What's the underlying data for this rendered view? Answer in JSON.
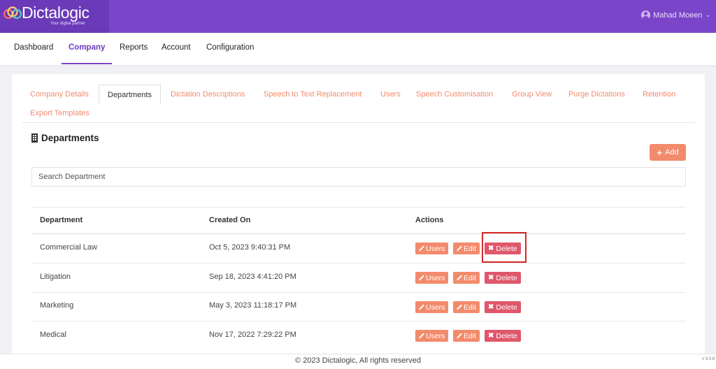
{
  "header": {
    "logo_text": "Dictalogic",
    "logo_tagline": "Your digital partner",
    "user_name": "Mahad Moeen"
  },
  "nav": {
    "items": [
      {
        "label": "Dashboard"
      },
      {
        "label": "Company"
      },
      {
        "label": "Reports"
      },
      {
        "label": "Account"
      },
      {
        "label": "Configuration"
      }
    ],
    "active": "Company"
  },
  "tabs": {
    "items": [
      {
        "label": "Company Details"
      },
      {
        "label": "Departments"
      },
      {
        "label": "Dictation Descriptions"
      },
      {
        "label": "Speech to Text Replacement"
      },
      {
        "label": "Users"
      },
      {
        "label": "Speech Customisation"
      },
      {
        "label": "Group View"
      },
      {
        "label": "Purge Dictations"
      },
      {
        "label": "Retention"
      },
      {
        "label": "Export Templates"
      }
    ],
    "active": "Departments"
  },
  "page": {
    "title": "Departments",
    "add_label": "Add",
    "search_placeholder": "Search Department"
  },
  "table": {
    "columns": [
      "Department",
      "Created On",
      "Actions"
    ],
    "actions": {
      "users": "Users",
      "edit": "Edit",
      "delete": "Delete"
    },
    "rows": [
      {
        "department": "Commercial Law",
        "created_on": "Oct 5, 2023 9:40:31 PM"
      },
      {
        "department": "Litigation",
        "created_on": "Sep 18, 2023 4:41:20 PM"
      },
      {
        "department": "Marketing",
        "created_on": "May 3, 2023 11:18:17 PM"
      },
      {
        "department": "Medical",
        "created_on": "Nov 17, 2022 7:29:22 PM"
      }
    ]
  },
  "footer": {
    "copyright": "© 2023 Dictalogic, All rights reserved",
    "version": "v 3.0.8"
  },
  "colors": {
    "header_bg": "#7b45c9",
    "accent": "#f28b6c",
    "danger": "#e0566a",
    "highlight": "#d62828"
  }
}
